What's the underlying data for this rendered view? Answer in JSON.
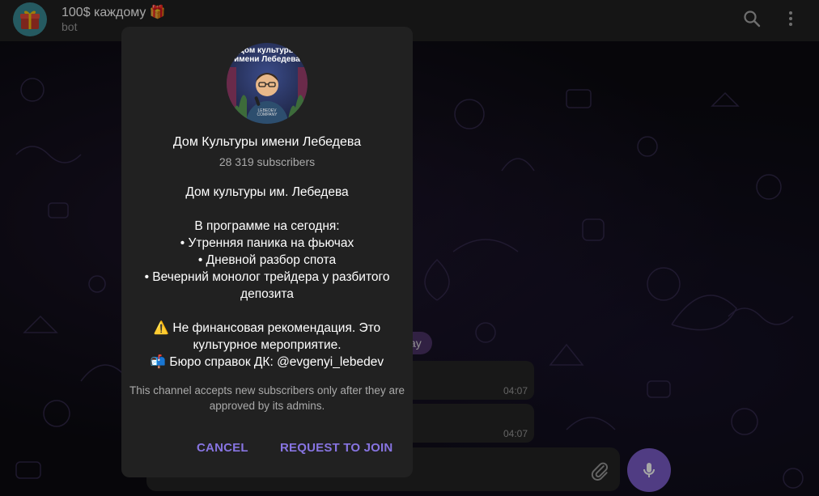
{
  "header": {
    "title": "100$ каждому 🎁",
    "subtitle": "bot",
    "search_icon": "search-icon",
    "more_icon": "more-vertical-icon"
  },
  "chat": {
    "date_pill": "ay",
    "messages": [
      {
        "time": "04:07"
      },
      {
        "time": "04:07"
      }
    ]
  },
  "composer": {
    "attach_icon": "paperclip-icon",
    "mic_icon": "microphone-icon"
  },
  "dialog": {
    "avatar_text_line1": "Дом культуры",
    "avatar_text_line2": "имени Лебедева",
    "avatar_shirt_text": "LEBEDEV COMPANY",
    "channel_name": "Дом Культуры имени Лебедева",
    "subscribers": "28 319 subscribers",
    "description": [
      "Дом культуры им. Лебедева",
      "",
      "В программе на сегодня:",
      "• Утренняя паника на фьючах",
      "• Дневной разбор спота",
      "• Вечерний монолог трейдера у разбитого депозита",
      "",
      "⚠️  Не финансовая рекомендация. Это культурное мероприятие.",
      "📬  Бюро справок ДК: @evgenyi_lebedev"
    ],
    "note": "This channel accepts new subscribers only after they are approved by its admins.",
    "cancel_label": "CANCEL",
    "join_label": "REQUEST TO JOIN"
  },
  "colors": {
    "accent": "#8774e1",
    "mic": "#7b5cc9",
    "dialog_bg": "#212121",
    "header_bg": "#212121"
  }
}
